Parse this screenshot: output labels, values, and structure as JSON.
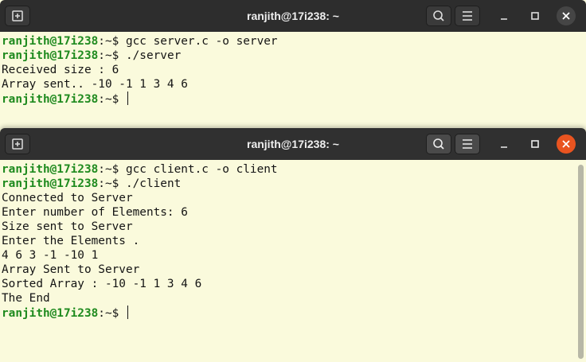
{
  "windows": [
    {
      "title": "ranjith@17i238: ~",
      "lines": [
        {
          "prompt": "ranjith@17i238",
          "sep": ":~$",
          "text": " gcc server.c -o server"
        },
        {
          "prompt": "ranjith@17i238",
          "sep": ":~$",
          "text": " ./server"
        },
        {
          "text": "Received size : 6"
        },
        {
          "text": "Array sent.. -10 -1 1 3 4 6"
        },
        {
          "prompt": "ranjith@17i238",
          "sep": ":~$",
          "text": " "
        }
      ]
    },
    {
      "title": "ranjith@17i238: ~",
      "lines": [
        {
          "prompt": "ranjith@17i238",
          "sep": ":~$",
          "text": " gcc client.c -o client"
        },
        {
          "prompt": "ranjith@17i238",
          "sep": ":~$",
          "text": " ./client"
        },
        {
          "text": "Connected to Server"
        },
        {
          "text": "Enter number of Elements: 6"
        },
        {
          "text": "Size sent to Server"
        },
        {
          "text": "Enter the Elements ."
        },
        {
          "text": "4 6 3 -1 -10 1"
        },
        {
          "text": "Array Sent to Server"
        },
        {
          "text": "Sorted Array : -10 -1 1 3 4 6"
        },
        {
          "text": "The End"
        },
        {
          "prompt": "ranjith@17i238",
          "sep": ":~$",
          "text": " "
        }
      ]
    }
  ],
  "icons": {
    "new_tab": "new-tab-icon",
    "search": "search-icon",
    "menu": "hamburger-menu-icon",
    "minimize": "minimize-icon",
    "maximize": "maximize-icon",
    "close": "close-icon"
  },
  "colors": {
    "terminal_bg": "#fafadc",
    "prompt": "#1e8a1e",
    "titlebar": "#2d2d2d",
    "close_active": "#e95420"
  }
}
